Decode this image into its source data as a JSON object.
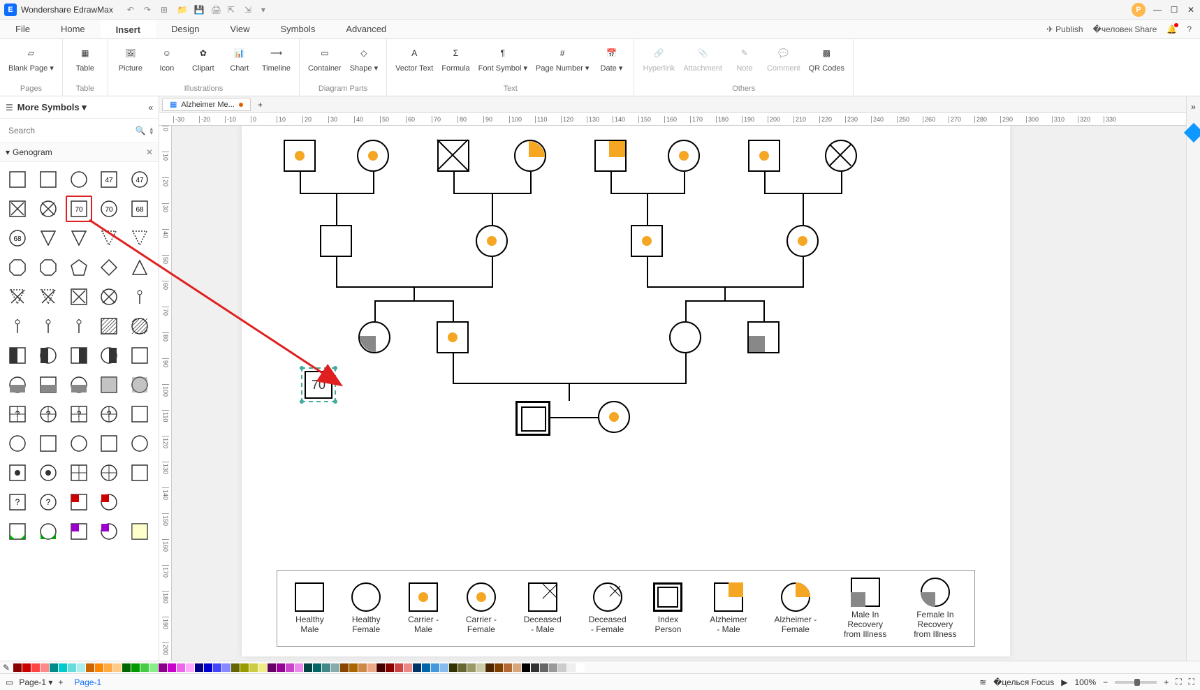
{
  "app": {
    "title": "Wondershare EdrawMax"
  },
  "menus": [
    "File",
    "Home",
    "Insert",
    "Design",
    "View",
    "Symbols",
    "Advanced"
  ],
  "active_menu": "Insert",
  "top_actions": {
    "publish": "Publish",
    "share": "Share"
  },
  "ribbon": {
    "groups": [
      {
        "label": "Pages",
        "items": [
          {
            "key": "blank-page",
            "label": "Blank\nPage ▾"
          }
        ]
      },
      {
        "label": "Table",
        "items": [
          {
            "key": "table",
            "label": "Table"
          }
        ]
      },
      {
        "label": "Illustrations",
        "items": [
          {
            "key": "picture",
            "label": "Picture"
          },
          {
            "key": "icon",
            "label": "Icon"
          },
          {
            "key": "clipart",
            "label": "Clipart"
          },
          {
            "key": "chart",
            "label": "Chart"
          },
          {
            "key": "timeline",
            "label": "Timeline"
          }
        ]
      },
      {
        "label": "Diagram Parts",
        "items": [
          {
            "key": "container",
            "label": "Container"
          },
          {
            "key": "shape",
            "label": "Shape ▾"
          }
        ]
      },
      {
        "label": "Text",
        "items": [
          {
            "key": "vector-text",
            "label": "Vector\nText"
          },
          {
            "key": "formula",
            "label": "Formula"
          },
          {
            "key": "font-symbol",
            "label": "Font\nSymbol ▾"
          },
          {
            "key": "page-number",
            "label": "Page\nNumber ▾"
          },
          {
            "key": "date",
            "label": "Date ▾"
          }
        ]
      },
      {
        "label": "Others",
        "items": [
          {
            "key": "hyperlink",
            "label": "Hyperlink",
            "disabled": true
          },
          {
            "key": "attachment",
            "label": "Attachment",
            "disabled": true
          },
          {
            "key": "note",
            "label": "Note",
            "disabled": true
          },
          {
            "key": "comment",
            "label": "Comment",
            "disabled": true
          },
          {
            "key": "qr",
            "label": "QR\nCodes"
          }
        ]
      }
    ]
  },
  "left": {
    "title": "More Symbols ▾",
    "search_placeholder": "Search",
    "section": "Genogram",
    "shape_labels": {
      "70": "70",
      "47": "47",
      "68": "68",
      "question": "?"
    }
  },
  "document": {
    "tab_name": "Alzheimer Me...",
    "modified": true
  },
  "ruler_h": [
    -30,
    -20,
    -10,
    0,
    10,
    20,
    30,
    40,
    50,
    60,
    70,
    80,
    90,
    100,
    110,
    120,
    130,
    140,
    150,
    160,
    170,
    180,
    190,
    200,
    210,
    220,
    230,
    240,
    250,
    260,
    270,
    280,
    290,
    300,
    310,
    320,
    330
  ],
  "ruler_v": [
    0,
    10,
    20,
    30,
    40,
    50,
    60,
    70,
    80,
    90,
    100,
    110,
    120,
    130,
    140,
    150,
    160,
    170,
    180,
    190,
    200
  ],
  "dropped_shape": {
    "label": "70"
  },
  "legend": [
    {
      "key": "healthy-male",
      "label": "Healthy\nMale"
    },
    {
      "key": "healthy-female",
      "label": "Healthy\nFemale"
    },
    {
      "key": "carrier-male",
      "label": "Carrier -\nMale"
    },
    {
      "key": "carrier-female",
      "label": "Carrier -\nFemale"
    },
    {
      "key": "deceased-male",
      "label": "Deceased\n- Male"
    },
    {
      "key": "deceased-female",
      "label": "Deceased\n- Female"
    },
    {
      "key": "index-person",
      "label": "Index\nPerson"
    },
    {
      "key": "alz-male",
      "label": "Alzheimer\n- Male"
    },
    {
      "key": "alz-female",
      "label": "Alzheimer -\nFemale"
    },
    {
      "key": "recovery-male",
      "label": "Male In\nRecovery\nfrom Illness"
    },
    {
      "key": "recovery-female",
      "label": "Female In\nRecovery\nfrom Illness"
    }
  ],
  "status": {
    "page_label": "Page-1",
    "page_tab": "Page-1",
    "focus": "Focus",
    "zoom": "100%"
  },
  "colors": [
    "#8b0000",
    "#cc0000",
    "#ff4444",
    "#ff8888",
    "#008b8b",
    "#00cccc",
    "#66dddd",
    "#aaeeee",
    "#cc6600",
    "#ff8800",
    "#ffaa44",
    "#ffcc88",
    "#006600",
    "#009900",
    "#44cc44",
    "#88ee88",
    "#8b008b",
    "#cc00cc",
    "#ee66ee",
    "#ffaaff",
    "#000088",
    "#0000cc",
    "#4444ff",
    "#8888ff",
    "#666600",
    "#999900",
    "#cccc44",
    "#eeee88",
    "#660066",
    "#990099",
    "#cc44cc",
    "#ee88ee",
    "#004444",
    "#006666",
    "#448888",
    "#88aaaa",
    "#884400",
    "#aa6600",
    "#cc8844",
    "#eeaa88",
    "#440000",
    "#880000",
    "#cc4444",
    "#ee8888",
    "#003366",
    "#0066aa",
    "#4499dd",
    "#88bbee",
    "#333300",
    "#666633",
    "#999966",
    "#ccccaa",
    "#4d2600",
    "#804000",
    "#b36b33",
    "#d9a679",
    "#000000",
    "#333333",
    "#666666",
    "#999999",
    "#cccccc",
    "#eeeeee",
    "#ffffff"
  ]
}
